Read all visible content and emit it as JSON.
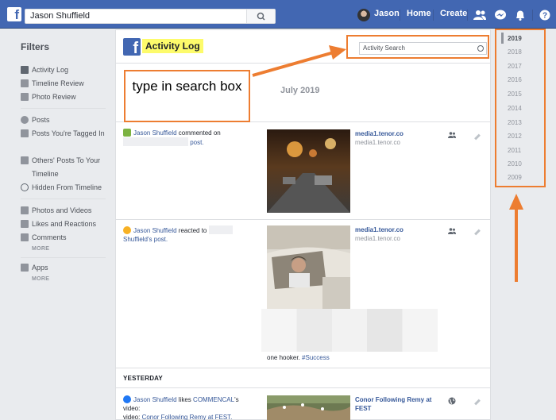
{
  "topbar": {
    "search_value": "Jason Shuffield",
    "profile_name": "Jason",
    "home": "Home",
    "create": "Create",
    "icons": [
      "friends-icon",
      "messenger-icon",
      "notifications-icon",
      "help-icon"
    ]
  },
  "sidebar": {
    "title": "Filters",
    "groups": [
      [
        {
          "label": "Activity Log",
          "icon": "facebook-icon"
        },
        {
          "label": "Timeline Review",
          "icon": "timeline-icon"
        },
        {
          "label": "Photo Review",
          "icon": "photo-review-icon"
        }
      ],
      [
        {
          "label": "Posts",
          "icon": "person-icon"
        },
        {
          "label": "Posts You're Tagged In",
          "icon": "tag-icon"
        },
        {
          "label": "Others' Posts To Your Timeline",
          "icon": "comment-icon"
        },
        {
          "label": "Hidden From Timeline",
          "icon": "hidden-icon"
        }
      ],
      [
        {
          "label": "Photos and Videos",
          "icon": "photos-icon"
        },
        {
          "label": "Likes and Reactions",
          "icon": "like-icon"
        },
        {
          "label": "Comments",
          "icon": "comments-icon"
        }
      ],
      [
        {
          "label": "Apps",
          "icon": "apps-icon"
        }
      ]
    ],
    "more": "MORE"
  },
  "main": {
    "title": "Activity Log",
    "search_placeholder": "Activity Search",
    "month": "July 2019",
    "yesterday_label": "YESTERDAY",
    "entries": [
      {
        "actor": "Jason Shuffield",
        "action": "commented on",
        "object": "post.",
        "link_title": "media1.tenor.co",
        "link_sub": "media1.tenor.co"
      },
      {
        "actor": "Jason Shuffield",
        "action": "reacted to",
        "object": "Shuffield's post.",
        "link_title": "media1.tenor.co",
        "link_sub": "media1.tenor.co",
        "caption": "one hooker.",
        "hashtag": "#Success"
      },
      {
        "actor": "Jason Shuffield",
        "action": "likes",
        "page": "COMMENCAL",
        "video_prefix": "'s video:",
        "video": "Conor Following Remy at FEST.",
        "link_title": "Conor Following Remy at FEST"
      }
    ]
  },
  "years": [
    "2019",
    "2018",
    "2017",
    "2016",
    "2015",
    "2014",
    "2013",
    "2012",
    "2011",
    "2010",
    "2009"
  ],
  "annotation": {
    "callout_text": "type in search box"
  },
  "colors": {
    "brand_blue": "#4267b2",
    "highlight_yellow": "#fdfb6b",
    "annotation_orange": "#ed7d31"
  }
}
